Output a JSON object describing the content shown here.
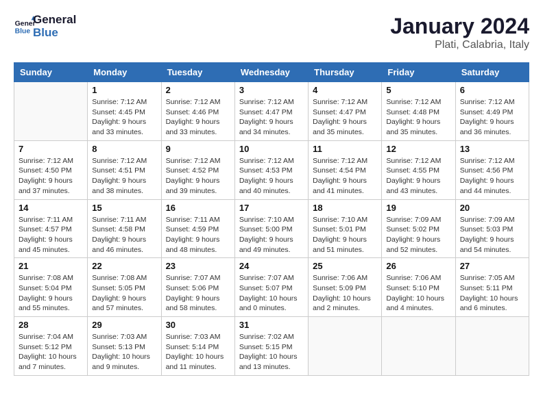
{
  "logo": {
    "line1": "General",
    "line2": "Blue"
  },
  "title": "January 2024",
  "subtitle": "Plati, Calabria, Italy",
  "weekdays": [
    "Sunday",
    "Monday",
    "Tuesday",
    "Wednesday",
    "Thursday",
    "Friday",
    "Saturday"
  ],
  "weeks": [
    [
      {
        "day": "",
        "info": ""
      },
      {
        "day": "1",
        "info": "Sunrise: 7:12 AM\nSunset: 4:45 PM\nDaylight: 9 hours\nand 33 minutes."
      },
      {
        "day": "2",
        "info": "Sunrise: 7:12 AM\nSunset: 4:46 PM\nDaylight: 9 hours\nand 33 minutes."
      },
      {
        "day": "3",
        "info": "Sunrise: 7:12 AM\nSunset: 4:47 PM\nDaylight: 9 hours\nand 34 minutes."
      },
      {
        "day": "4",
        "info": "Sunrise: 7:12 AM\nSunset: 4:47 PM\nDaylight: 9 hours\nand 35 minutes."
      },
      {
        "day": "5",
        "info": "Sunrise: 7:12 AM\nSunset: 4:48 PM\nDaylight: 9 hours\nand 35 minutes."
      },
      {
        "day": "6",
        "info": "Sunrise: 7:12 AM\nSunset: 4:49 PM\nDaylight: 9 hours\nand 36 minutes."
      }
    ],
    [
      {
        "day": "7",
        "info": "Sunrise: 7:12 AM\nSunset: 4:50 PM\nDaylight: 9 hours\nand 37 minutes."
      },
      {
        "day": "8",
        "info": "Sunrise: 7:12 AM\nSunset: 4:51 PM\nDaylight: 9 hours\nand 38 minutes."
      },
      {
        "day": "9",
        "info": "Sunrise: 7:12 AM\nSunset: 4:52 PM\nDaylight: 9 hours\nand 39 minutes."
      },
      {
        "day": "10",
        "info": "Sunrise: 7:12 AM\nSunset: 4:53 PM\nDaylight: 9 hours\nand 40 minutes."
      },
      {
        "day": "11",
        "info": "Sunrise: 7:12 AM\nSunset: 4:54 PM\nDaylight: 9 hours\nand 41 minutes."
      },
      {
        "day": "12",
        "info": "Sunrise: 7:12 AM\nSunset: 4:55 PM\nDaylight: 9 hours\nand 43 minutes."
      },
      {
        "day": "13",
        "info": "Sunrise: 7:12 AM\nSunset: 4:56 PM\nDaylight: 9 hours\nand 44 minutes."
      }
    ],
    [
      {
        "day": "14",
        "info": "Sunrise: 7:11 AM\nSunset: 4:57 PM\nDaylight: 9 hours\nand 45 minutes."
      },
      {
        "day": "15",
        "info": "Sunrise: 7:11 AM\nSunset: 4:58 PM\nDaylight: 9 hours\nand 46 minutes."
      },
      {
        "day": "16",
        "info": "Sunrise: 7:11 AM\nSunset: 4:59 PM\nDaylight: 9 hours\nand 48 minutes."
      },
      {
        "day": "17",
        "info": "Sunrise: 7:10 AM\nSunset: 5:00 PM\nDaylight: 9 hours\nand 49 minutes."
      },
      {
        "day": "18",
        "info": "Sunrise: 7:10 AM\nSunset: 5:01 PM\nDaylight: 9 hours\nand 51 minutes."
      },
      {
        "day": "19",
        "info": "Sunrise: 7:09 AM\nSunset: 5:02 PM\nDaylight: 9 hours\nand 52 minutes."
      },
      {
        "day": "20",
        "info": "Sunrise: 7:09 AM\nSunset: 5:03 PM\nDaylight: 9 hours\nand 54 minutes."
      }
    ],
    [
      {
        "day": "21",
        "info": "Sunrise: 7:08 AM\nSunset: 5:04 PM\nDaylight: 9 hours\nand 55 minutes."
      },
      {
        "day": "22",
        "info": "Sunrise: 7:08 AM\nSunset: 5:05 PM\nDaylight: 9 hours\nand 57 minutes."
      },
      {
        "day": "23",
        "info": "Sunrise: 7:07 AM\nSunset: 5:06 PM\nDaylight: 9 hours\nand 58 minutes."
      },
      {
        "day": "24",
        "info": "Sunrise: 7:07 AM\nSunset: 5:07 PM\nDaylight: 10 hours\nand 0 minutes."
      },
      {
        "day": "25",
        "info": "Sunrise: 7:06 AM\nSunset: 5:09 PM\nDaylight: 10 hours\nand 2 minutes."
      },
      {
        "day": "26",
        "info": "Sunrise: 7:06 AM\nSunset: 5:10 PM\nDaylight: 10 hours\nand 4 minutes."
      },
      {
        "day": "27",
        "info": "Sunrise: 7:05 AM\nSunset: 5:11 PM\nDaylight: 10 hours\nand 6 minutes."
      }
    ],
    [
      {
        "day": "28",
        "info": "Sunrise: 7:04 AM\nSunset: 5:12 PM\nDaylight: 10 hours\nand 7 minutes."
      },
      {
        "day": "29",
        "info": "Sunrise: 7:03 AM\nSunset: 5:13 PM\nDaylight: 10 hours\nand 9 minutes."
      },
      {
        "day": "30",
        "info": "Sunrise: 7:03 AM\nSunset: 5:14 PM\nDaylight: 10 hours\nand 11 minutes."
      },
      {
        "day": "31",
        "info": "Sunrise: 7:02 AM\nSunset: 5:15 PM\nDaylight: 10 hours\nand 13 minutes."
      },
      {
        "day": "",
        "info": ""
      },
      {
        "day": "",
        "info": ""
      },
      {
        "day": "",
        "info": ""
      }
    ]
  ]
}
